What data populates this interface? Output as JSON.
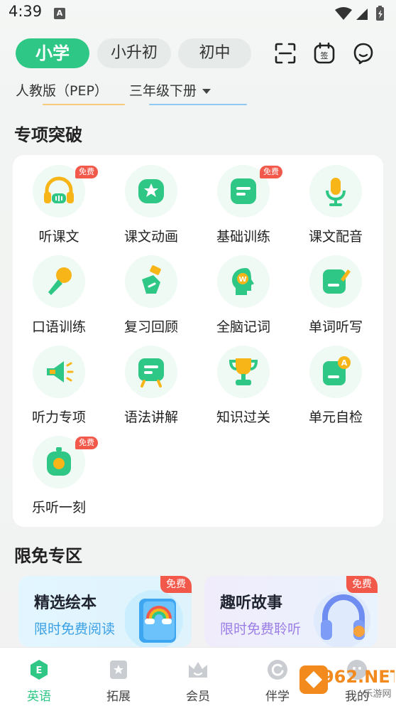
{
  "status_bar": {
    "time": "4:39",
    "notif_letter": "A"
  },
  "level_tabs": [
    {
      "label": "小学",
      "active": true
    },
    {
      "label": "小升初",
      "active": false
    },
    {
      "label": "初中",
      "active": false
    }
  ],
  "top_icons": [
    "scan-icon",
    "sign-in-icon",
    "message-icon"
  ],
  "textbook": {
    "publisher": "人教版（PEP）",
    "grade": "三年级下册"
  },
  "special_section": {
    "title": "专项突破",
    "badge_text": "免费",
    "items": [
      {
        "label": "听课文",
        "icon": "headphones-icon",
        "free": true
      },
      {
        "label": "课文动画",
        "icon": "tv-star-icon",
        "free": false
      },
      {
        "label": "基础训练",
        "icon": "chat-card-icon",
        "free": true
      },
      {
        "label": "课文配音",
        "icon": "microphone-icon",
        "free": false
      },
      {
        "label": "口语训练",
        "icon": "handheld-mic-icon",
        "free": false
      },
      {
        "label": "复习回顾",
        "icon": "review-book-icon",
        "free": false
      },
      {
        "label": "全脑记词",
        "icon": "brain-head-icon",
        "free": false
      },
      {
        "label": "单词听写",
        "icon": "dictation-pen-icon",
        "free": false
      },
      {
        "label": "听力专项",
        "icon": "speaker-icon",
        "free": false
      },
      {
        "label": "语法讲解",
        "icon": "grammar-card-icon",
        "free": false
      },
      {
        "label": "知识过关",
        "icon": "trophy-icon",
        "free": false
      },
      {
        "label": "单元自检",
        "icon": "self-check-icon",
        "free": false
      },
      {
        "label": "乐听一刻",
        "icon": "timer-icon",
        "free": true
      }
    ]
  },
  "free_zone": {
    "title": "限免专区",
    "cards": [
      {
        "title": "精选绘本",
        "subtitle": "限时免费阅读",
        "badge": "免费",
        "icon": "picture-book-icon"
      },
      {
        "title": "趣听故事",
        "subtitle": "限时免费聆听",
        "badge": "免费",
        "icon": "headset-icon"
      }
    ]
  },
  "bottom_nav": [
    {
      "label": "英语",
      "icon": "english-icon",
      "active": true
    },
    {
      "label": "拓展",
      "icon": "expand-icon",
      "active": false
    },
    {
      "label": "会员",
      "icon": "member-crown-icon",
      "active": false
    },
    {
      "label": "伴学",
      "icon": "companion-icon",
      "active": false
    },
    {
      "label": "我的",
      "icon": "profile-icon",
      "active": false
    }
  ],
  "colors": {
    "accent": "#2ec785",
    "badge": "#f2594b",
    "blue_text": "#3aa0e5",
    "purple_text": "#9b7de6"
  },
  "watermark": {
    "text": "962.NET",
    "sub": "乐游网"
  }
}
